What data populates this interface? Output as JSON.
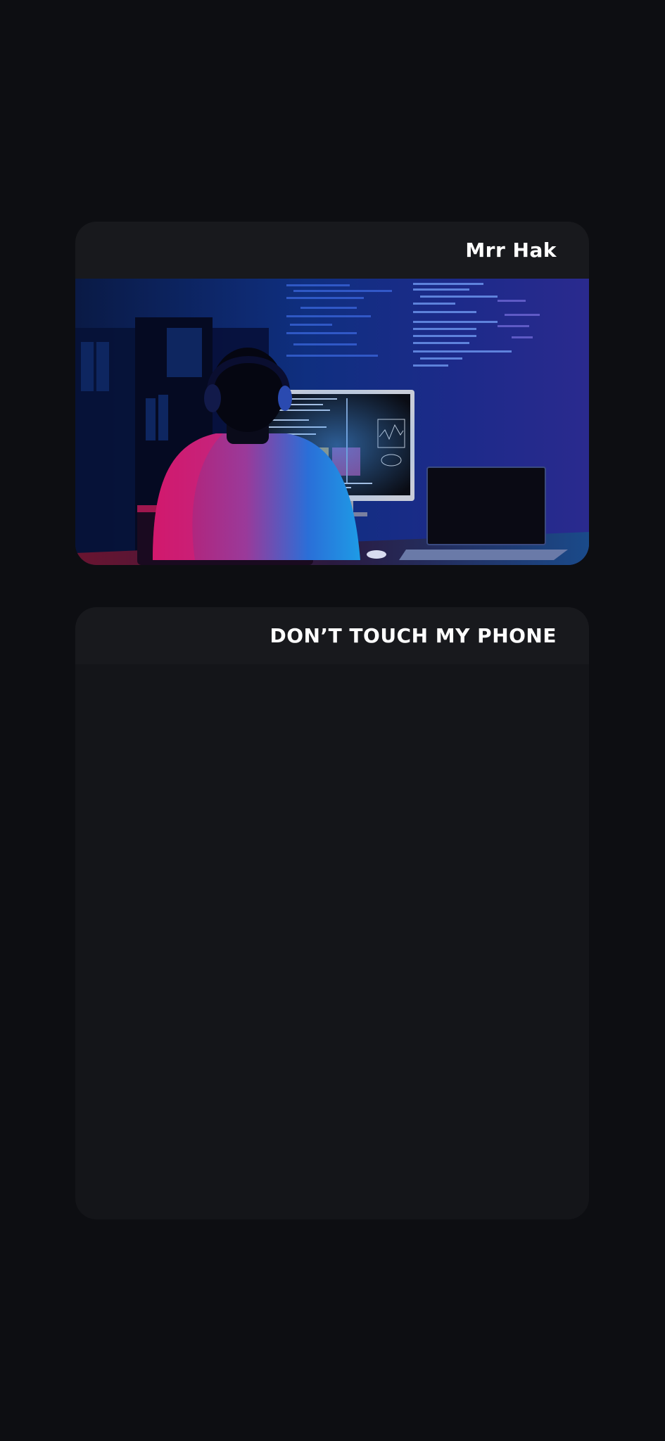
{
  "cards": [
    {
      "title": "Mrr Hak",
      "image": "hacker-at-computer-photo"
    },
    {
      "title": "DON’T TOUCH MY PHONE"
    }
  ],
  "colors": {
    "background": "#0d0e12",
    "card": "#141519",
    "card_header": "#18191d",
    "title_text": "#ffffff"
  }
}
